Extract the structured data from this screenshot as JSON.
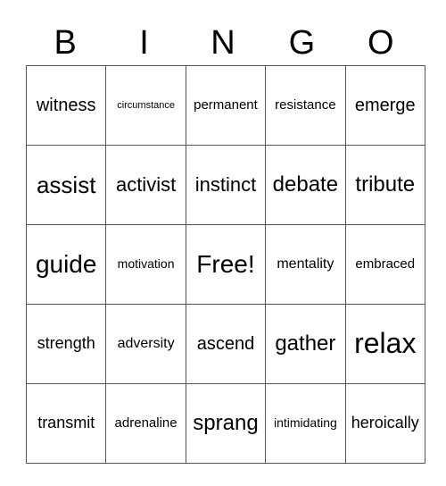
{
  "header": {
    "letters": [
      "B",
      "I",
      "N",
      "G",
      "O"
    ]
  },
  "grid": {
    "rows": [
      [
        "witness",
        "circumstance",
        "permanent",
        "resistance",
        "emerge"
      ],
      [
        "assist",
        "activist",
        "instinct",
        "debate",
        "tribute"
      ],
      [
        "guide",
        "motivation",
        "Free!",
        "mentality",
        "embraced"
      ],
      [
        "strength",
        "adversity",
        "ascend",
        "gather",
        "relax"
      ],
      [
        "transmit",
        "adrenaline",
        "sprang",
        "intimidating",
        "heroically"
      ]
    ]
  }
}
